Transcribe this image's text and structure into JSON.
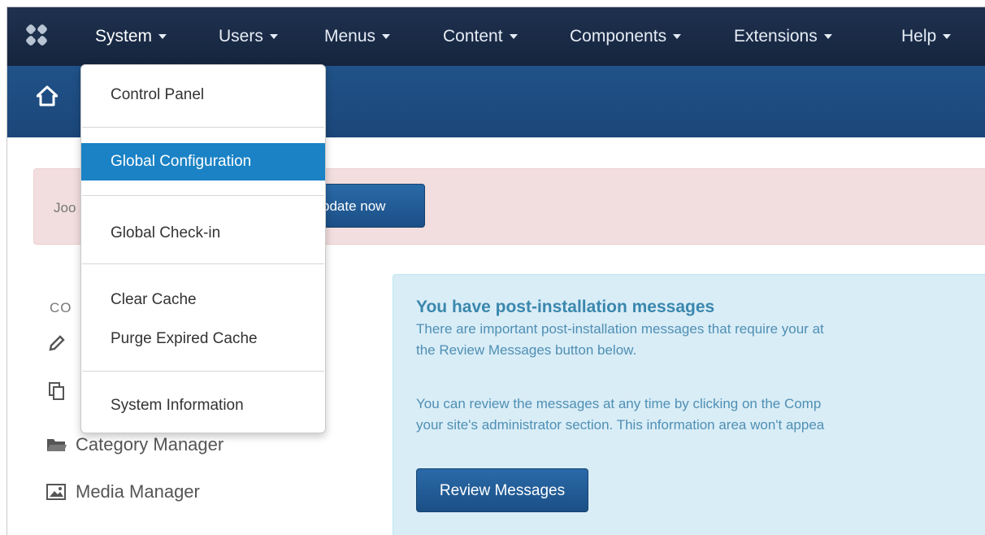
{
  "navbar": {
    "menus": [
      {
        "label": "System"
      },
      {
        "label": "Users"
      },
      {
        "label": "Menus"
      },
      {
        "label": "Content"
      },
      {
        "label": "Components"
      },
      {
        "label": "Extensions"
      },
      {
        "label": "Help"
      }
    ]
  },
  "dropdown": {
    "items": [
      {
        "label": "Control Panel"
      },
      {
        "label": "Global Configuration",
        "highlighted": true
      },
      {
        "label": "Global Check-in"
      },
      {
        "label": "Clear Cache"
      },
      {
        "label": "Purge Expired Cache"
      },
      {
        "label": "System Information"
      }
    ]
  },
  "alert": {
    "text_visible": "Joo",
    "button_label": "pdate now"
  },
  "sidebar": {
    "section_heading": "CO",
    "items": [
      {
        "label": "Category Manager",
        "icon": "folder-icon"
      },
      {
        "label": "Media Manager",
        "icon": "image-icon"
      }
    ]
  },
  "info": {
    "title": "You have post-installation messages",
    "line1": "There are important post-installation messages that require your at",
    "line2": "the Review Messages button below.",
    "line3": "You can review the messages at any time by clicking on the Comp",
    "line4": "your site's administrator section. This information area won't appea",
    "button_label": "Review Messages"
  },
  "colors": {
    "navbar": "#1a2b45",
    "subheader": "#1d4c80",
    "alert_bg": "#f2dede",
    "info_bg": "#d9edf7",
    "highlight": "#1a82c5",
    "button": "#1b4f86"
  }
}
